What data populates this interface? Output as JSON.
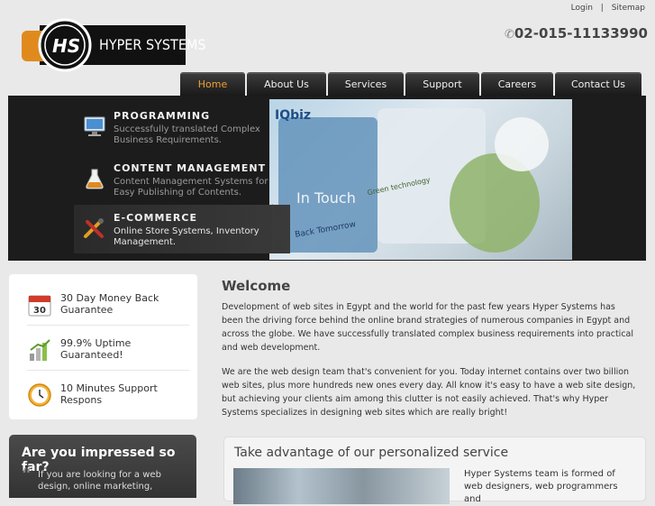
{
  "header": {
    "links": {
      "login": "Login",
      "separator": "|",
      "sitemap": "Sitemap"
    },
    "logo_text": "HYPER SYSTEMS",
    "phone": "02-015-11133990"
  },
  "nav": {
    "tabs": [
      {
        "label": "Home",
        "active": true
      },
      {
        "label": "About Us"
      },
      {
        "label": "Services"
      },
      {
        "label": "Support"
      },
      {
        "label": "Careers"
      },
      {
        "label": "Contact Us"
      }
    ]
  },
  "banner": {
    "items": [
      {
        "title": "PROGRAMMING",
        "desc": "Successfully translated Complex Business Requirements.",
        "icon": "monitor-icon"
      },
      {
        "title": "CONTENT MANAGEMENT",
        "desc": "Content Management Systems for Easy Publishing of Contents.",
        "icon": "flask-icon"
      },
      {
        "title": "E-COMMERCE",
        "desc": "Online Store Systems, Inventory Management.",
        "icon": "tools-icon"
      }
    ],
    "photo_words": {
      "a": "IQbiz",
      "b": "In Touch",
      "c": "Green technology",
      "d": "Back Tomorrow"
    }
  },
  "features": [
    {
      "text": "30 Day Money Back Guarantee",
      "icon": "calendar-icon",
      "calendar_day": "30"
    },
    {
      "text": "99.9% Uptime Guaranteed!",
      "icon": "bar-chart-icon"
    },
    {
      "text": "10 Minutes Support Respons",
      "icon": "clock-icon"
    }
  ],
  "impressed": {
    "title": "Are you impressed so far?",
    "text": "If you are looking for a web design, online marketing,"
  },
  "welcome": {
    "title": "Welcome",
    "p1": "Development of web sites in Egypt and the world for the past few years Hyper Systems has been the driving force behind the online brand strategies of numerous companies in Egypt and across the globe. We have successfully translated complex business requirements into practical and web development.",
    "p2": "We are the web design team that's convenient for you. Today internet contains over two billion web sites, plus more hundreds new ones every day. All know it's easy to have a web site design, but achieving your clients aim among this clutter is not easily achieved. That's why Hyper Systems specializes in designing web sites which are really bright!"
  },
  "service": {
    "title": "Take advantage of our personalized service",
    "text": "Hyper Systems team is formed of web designers, web programmers and"
  },
  "colors": {
    "accent": "#f0a030",
    "nav_bg": "#1a1a1a",
    "banner_bg": "#1c1c1c"
  }
}
